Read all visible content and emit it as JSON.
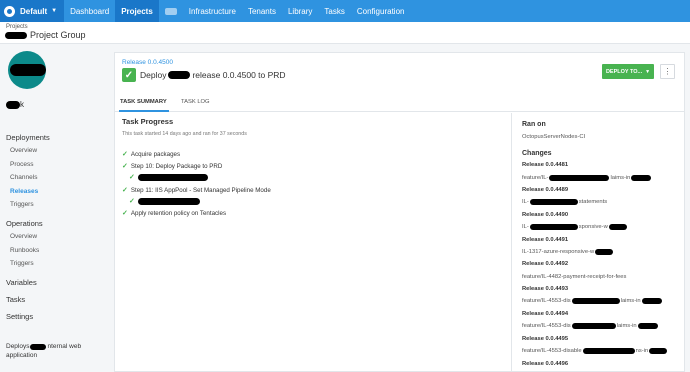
{
  "topnav": {
    "space": "Default",
    "items": [
      "Dashboard",
      "Projects",
      "Infrastructure",
      "Tenants",
      "Library",
      "Tasks",
      "Configuration"
    ],
    "active": "Projects"
  },
  "breadcrumb": {
    "parent": "Projects",
    "group_suffix": "Project Group"
  },
  "project": {
    "name_suffix": "k"
  },
  "sidebar": {
    "deployments_heading": "Deployments",
    "deployments_items": [
      "Overview",
      "Process",
      "Channels",
      "Releases",
      "Triggers"
    ],
    "operations_heading": "Operations",
    "operations_items": [
      "Overview",
      "Runbooks",
      "Triggers"
    ],
    "bottom_items": [
      "Variables",
      "Tasks",
      "Settings"
    ],
    "footer_prefix": "Deploys",
    "footer_suffix": "nternal web",
    "footer_line2": "application"
  },
  "release": {
    "link": "Release 0.0.4500",
    "title_prefix": "Deploy",
    "title_suffix": "release 0.0.4500 to PRD",
    "deploy_button": "DEPLOY TO...",
    "more": "⋮"
  },
  "tabs": [
    "TASK SUMMARY",
    "TASK LOG"
  ],
  "task": {
    "heading": "Task Progress",
    "subtitle": "This task started 14 days ago and ran for 37 seconds",
    "steps": [
      "Acquire packages",
      "Step 10: Deploy Package to PRD",
      "Step 11: IIS AppPool - Set Managed Pipeline Mode",
      "Apply retention policy on Tentacles"
    ]
  },
  "details": {
    "ran_on_heading": "Ran on",
    "ran_on_value": "OctopusServerNodes-CI",
    "changes_heading": "Changes",
    "changes": [
      {
        "release": "Release 0.0.4481",
        "note_prefix": "feature/IL-",
        "note_suffix": "laims-in"
      },
      {
        "release": "Release 0.0.4489",
        "note_prefix": "IL-",
        "note_suffix": "statements"
      },
      {
        "release": "Release 0.0.4490",
        "note_prefix": "IL-",
        "note_suffix": "sponsive-w"
      },
      {
        "release": "Release 0.0.4491",
        "note_prefix": "IL-1317-azure-responsive-w",
        "note_suffix": ""
      },
      {
        "release": "Release 0.0.4492",
        "note_prefix": "feature/IL-4482-payment-receipt-for-fees",
        "note_suffix": ""
      },
      {
        "release": "Release 0.0.4493",
        "note_prefix": "feature/IL-4553-dis",
        "note_suffix": "laims-in"
      },
      {
        "release": "Release 0.0.4494",
        "note_prefix": "feature/IL-4553-dis",
        "note_suffix": "laims-in"
      },
      {
        "release": "Release 0.0.4495",
        "note_prefix": "feature/IL-4553-disable",
        "note_suffix": "ns-in"
      },
      {
        "release": "Release 0.0.4496",
        "note_prefix": "",
        "note_suffix": ""
      }
    ]
  },
  "colors": {
    "nav_blue": "#2f93e0",
    "nav_dark": "#1a77c9",
    "success_green": "#48b350",
    "avatar_teal": "#0c8a8a"
  }
}
